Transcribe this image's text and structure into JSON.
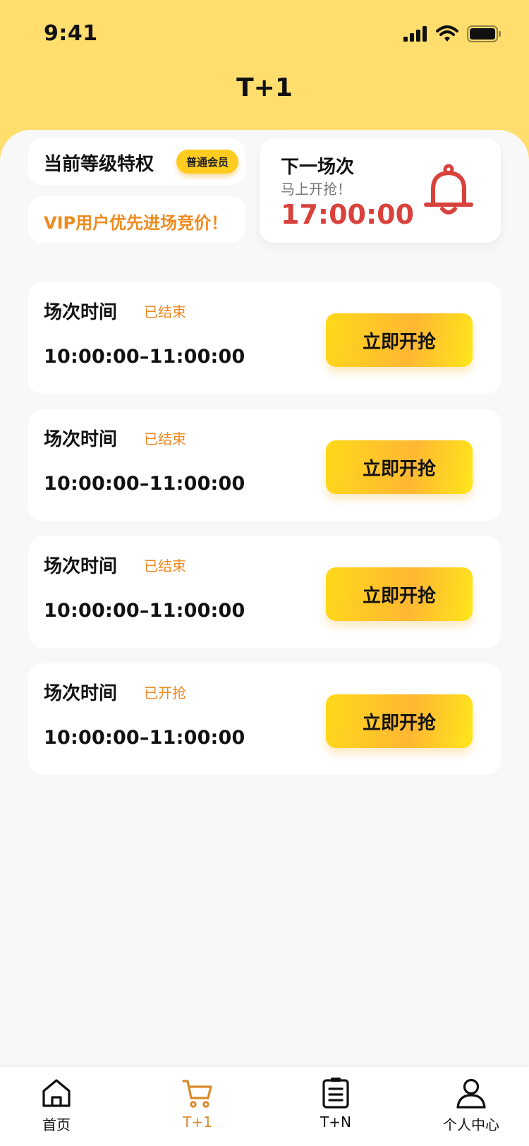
{
  "status_bar": {
    "time": "9:41"
  },
  "header": {
    "title": "T+1"
  },
  "privilege": {
    "title": "当前等级特权",
    "badge": "普通会员",
    "vip_text": "VIP用户优先进场竞价！"
  },
  "next_session": {
    "title": "下一场次",
    "subtitle": "马上开抢！",
    "time": "17:00:00"
  },
  "sessions": [
    {
      "label": "场次时间",
      "status": "已结束",
      "time": "10:00:00–11:00:00",
      "button": "立即开抢"
    },
    {
      "label": "场次时间",
      "status": "已结束",
      "time": "10:00:00–11:00:00",
      "button": "立即开抢"
    },
    {
      "label": "场次时间",
      "status": "已结束",
      "time": "10:00:00–11:00:00",
      "button": "立即开抢"
    },
    {
      "label": "场次时间",
      "status": "已开抢",
      "time": "10:00:00–11:00:00",
      "button": "立即开抢"
    }
  ],
  "nav": {
    "items": [
      {
        "label": "首页",
        "icon": "home-icon",
        "active": false
      },
      {
        "label": "T+1",
        "icon": "cart-icon",
        "active": true
      },
      {
        "label": "T+N",
        "icon": "list-icon",
        "active": false
      },
      {
        "label": "个人中心",
        "icon": "user-icon",
        "active": false
      }
    ]
  },
  "colors": {
    "header_bg": "#ffde6e",
    "accent_orange": "#f08a1e",
    "countdown_red": "#d9413c",
    "nav_active": "#d98a2a"
  }
}
